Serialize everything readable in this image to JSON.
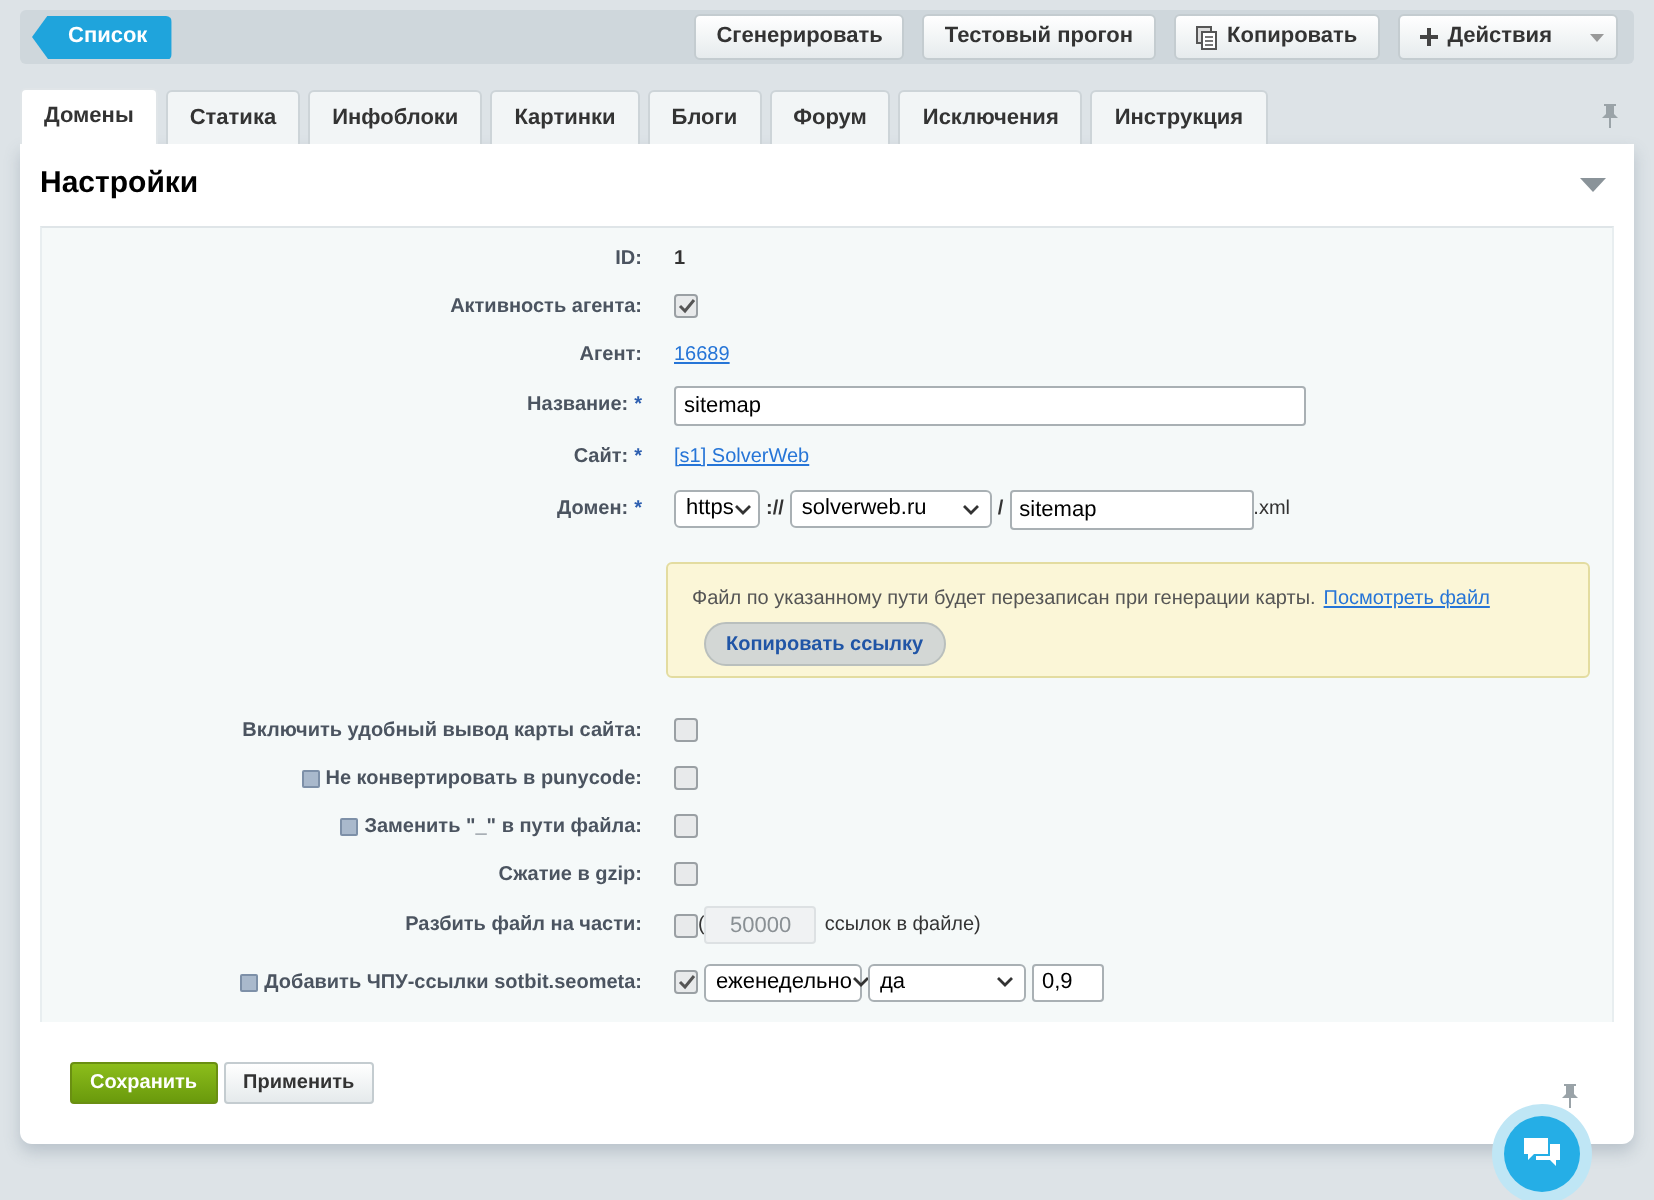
{
  "toolbar": {
    "back_button": "Список",
    "buttons": [
      {
        "label": "Сгенерировать",
        "kind": "plain"
      },
      {
        "label": "Тестовый прогон",
        "kind": "plain"
      },
      {
        "label": "Копировать",
        "kind": "copy"
      },
      {
        "label": "Действия",
        "kind": "actions"
      }
    ]
  },
  "tabs": [
    {
      "label": "Домены",
      "selected": true
    },
    {
      "label": "Статика",
      "selected": false
    },
    {
      "label": "Инфоблоки",
      "selected": false
    },
    {
      "label": "Картинки",
      "selected": false
    },
    {
      "label": "Блоги",
      "selected": false
    },
    {
      "label": "Форум",
      "selected": false
    },
    {
      "label": "Исключения",
      "selected": false
    },
    {
      "label": "Инструкция",
      "selected": false
    }
  ],
  "section": {
    "title": "Настройки",
    "expanded": true
  },
  "fields": [
    {
      "kind": "text",
      "label": "ID:",
      "value": "1"
    },
    {
      "kind": "checkbox",
      "label": "Активность агента:",
      "checked": true
    },
    {
      "kind": "link",
      "label": "Агент:",
      "value": "16689"
    },
    {
      "kind": "input",
      "label": "Название:",
      "required_mark": "*",
      "value": "sitemap"
    },
    {
      "kind": "link",
      "label": "Сайт:",
      "required_mark": "*",
      "value": "[s1] SolverWeb"
    },
    {
      "kind": "domain",
      "label": "Домен:",
      "required_mark": "*",
      "protocol": "https",
      "separator": "://",
      "host": "solverweb.ru",
      "slash": "/",
      "path": "sitemap",
      "suffix": ".xml"
    },
    {
      "kind": "note",
      "text": "Файл по указанному пути будет перезаписан при генерации карты.",
      "link": "Посмотреть файл",
      "button": "Копировать ссылку"
    },
    {
      "kind": "checkbox",
      "label": "Включить удобный вывод карты сайта:",
      "checked": false
    },
    {
      "kind": "checkbox",
      "label": "Не конвертировать в punycode:",
      "help": true,
      "checked": false
    },
    {
      "kind": "checkbox",
      "label": "Заменить \"_\" в пути файла:",
      "help": true,
      "checked": false
    },
    {
      "kind": "checkbox",
      "label": "Сжатие в gzip:",
      "checked": false
    },
    {
      "kind": "split",
      "label": "Разбить файл на части:",
      "checked": false,
      "prefix": "(",
      "placeholder": "50000",
      "disabled": true,
      "suffix": "ссылок в файле)"
    },
    {
      "kind": "seometa",
      "label": "Добавить ЧПУ-ссылки sotbit.seometa:",
      "help": true,
      "checked": true,
      "frequency": "еженедельно",
      "option": "да",
      "value": "0,9"
    }
  ],
  "footer": {
    "buttons": [
      {
        "label": "Сохранить",
        "kind": "primary"
      },
      {
        "label": "Применить",
        "kind": "plain"
      }
    ]
  }
}
